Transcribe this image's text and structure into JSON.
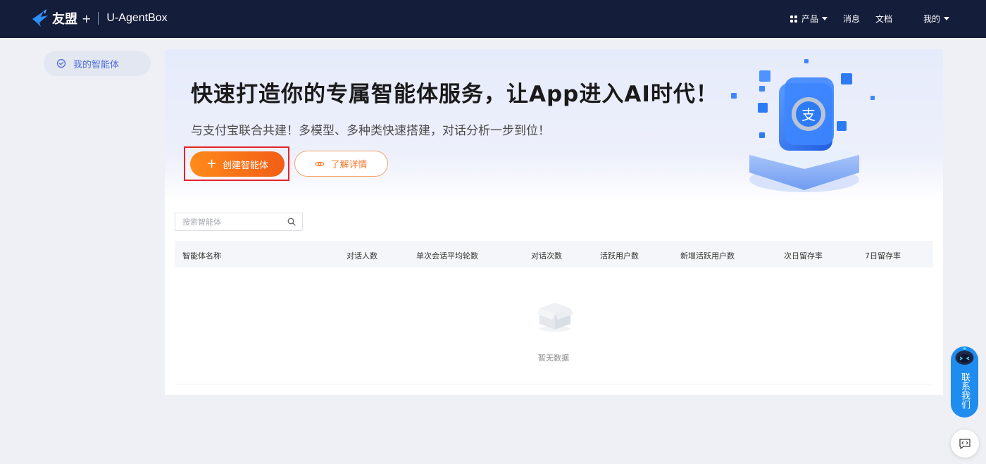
{
  "header": {
    "brand": "友盟",
    "brand_plus": "+",
    "product_name": "U-AgentBox",
    "nav": {
      "products": "产品",
      "messages": "消息",
      "docs": "文档",
      "mine": "我的"
    }
  },
  "sidebar": {
    "items": [
      {
        "label": "我的智能体",
        "icon": "check-circle-icon"
      }
    ]
  },
  "banner": {
    "title": "快速打造你的专属智能体服务，让App进入AI时代！",
    "subtitle": "与支付宝联合共建！多模型、多种类快速搭建，对话分析一步到位！",
    "create_label": "创建智能体",
    "detail_label": "了解详情"
  },
  "search": {
    "placeholder": "搜索智能体",
    "value": ""
  },
  "table": {
    "columns": [
      "智能体名称",
      "对话人数",
      "单次会话平均轮数",
      "对话次数",
      "活跃用户数",
      "新增活跃用户数",
      "次日留存率",
      "7日留存率"
    ],
    "rows": [],
    "empty_text": "暂无数据"
  },
  "float": {
    "contact_label": "联系我们"
  },
  "colors": {
    "topbar": "#141d3a",
    "accent_orange": "#f5731b",
    "highlight_red": "#e5232c",
    "accent_blue": "#1f8cf0"
  }
}
